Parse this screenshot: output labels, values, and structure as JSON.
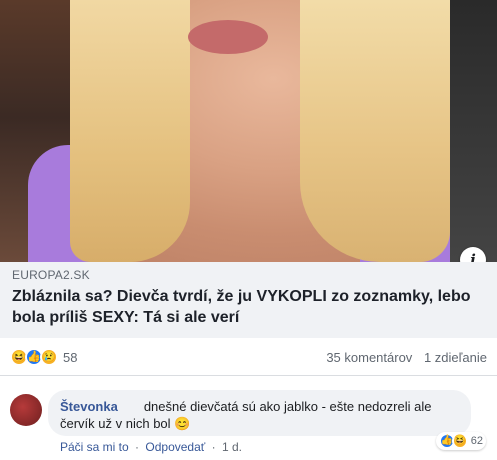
{
  "post": {
    "domain": "EUROPA2.SK",
    "headline": "Zbláznila sa? Dievča tvrdí, že ju VYKOPLI zo zoznamky, lebo bola príliš SEXY: Tá si ale verí",
    "info_icon": "i"
  },
  "stats": {
    "reaction_icons": [
      "haha-icon",
      "like-icon",
      "sad-icon"
    ],
    "reaction_count": "58",
    "comments": "35 komentárov",
    "shares": "1 zdieľanie"
  },
  "comment": {
    "author": "Števonka",
    "text": "dnešné dievčatá sú ako jablko - ešte nedozreli ale červík už v nich bol",
    "emoji": "😊",
    "reaction_count": "62",
    "actions": {
      "like": "Páči sa mi to",
      "sep1": "·",
      "reply": "Odpovedať",
      "sep2": "·",
      "time": "1 d."
    }
  },
  "colors": {
    "link_blue": "#385898",
    "like_blue": "#2078f4",
    "haha_yellow": "#f7b125",
    "bubble_bg": "#f0f2f5",
    "muted_text": "#606770"
  }
}
